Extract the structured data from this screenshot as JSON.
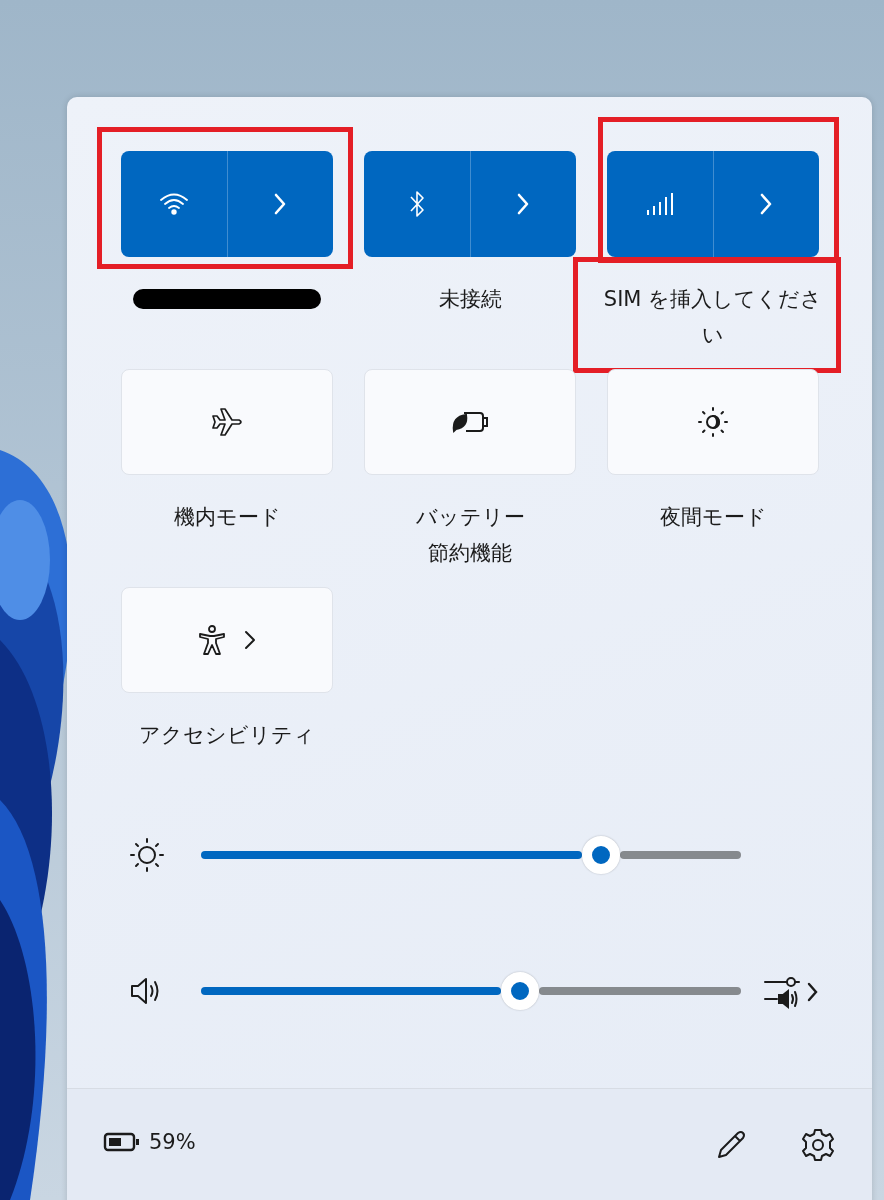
{
  "tiles": [
    {
      "kind": "split",
      "on": true,
      "label_redacted": true,
      "highlight_button": true
    },
    {
      "kind": "split",
      "on": true,
      "label": "未接続"
    },
    {
      "kind": "split",
      "on": true,
      "label": "SIM を挿入してください",
      "highlight_button": true,
      "highlight_label": true
    },
    {
      "kind": "single",
      "on": false,
      "label": "機内モード"
    },
    {
      "kind": "single",
      "on": false,
      "label": "バッテリー節約機能"
    },
    {
      "kind": "single",
      "on": false,
      "label": "夜間モード"
    },
    {
      "kind": "chevron",
      "on": false,
      "label": "アクセシビリティ"
    }
  ],
  "sliders": [
    {
      "kind": "brightness",
      "level": 0.74
    },
    {
      "kind": "volume",
      "level": 0.59
    }
  ],
  "footer": {
    "battery": "59%"
  }
}
